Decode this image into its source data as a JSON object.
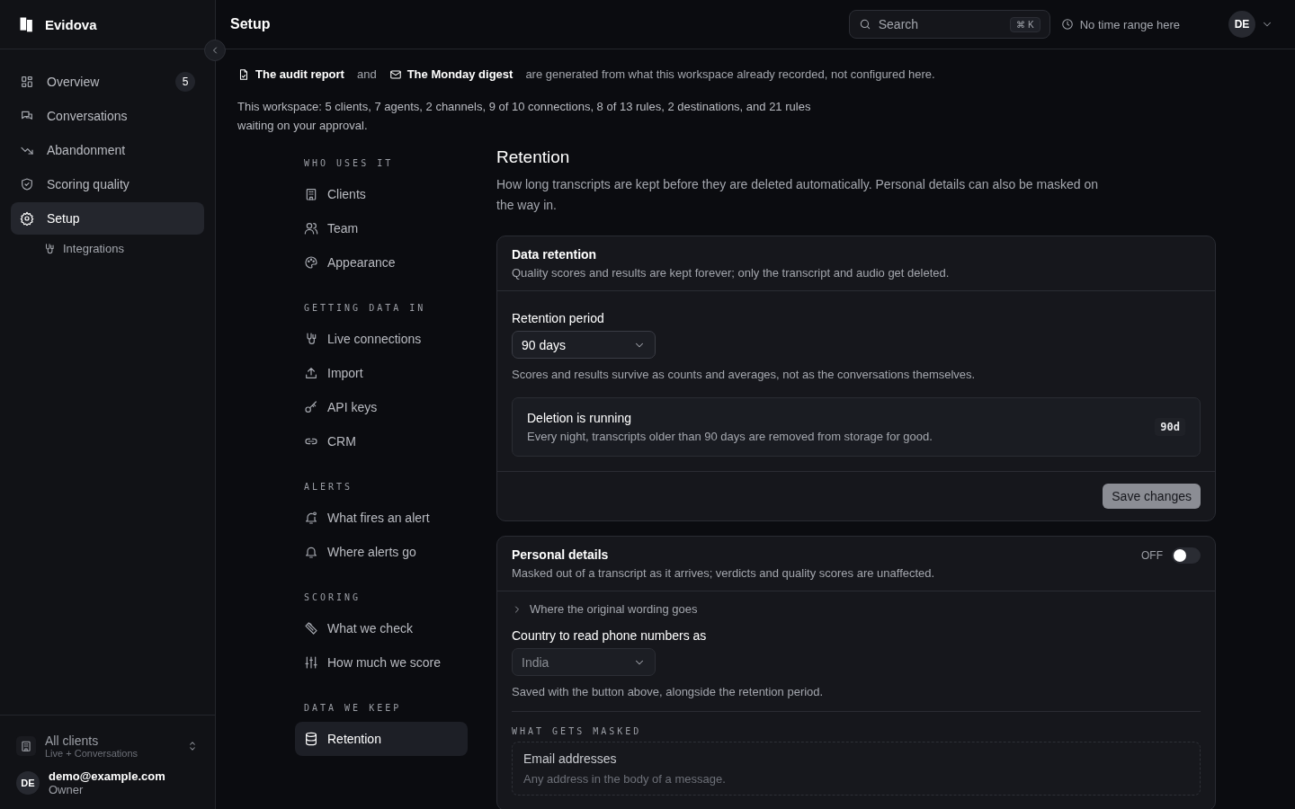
{
  "sidebar": {
    "brand": "Evidova",
    "nav": [
      {
        "label": "Overview",
        "badge": "5",
        "selected": false
      },
      {
        "label": "Conversations",
        "selected": false
      },
      {
        "label": "Abandonment",
        "selected": false
      },
      {
        "label": "Scoring quality",
        "selected": false
      },
      {
        "label": "Setup",
        "selected": true,
        "children": [
          {
            "label": "Integrations",
            "selected": false
          }
        ]
      }
    ],
    "client_switcher": {
      "title": "All clients",
      "subtitle": "Live + Conversations"
    },
    "user": {
      "initials": "DE",
      "email": "demo@example.com",
      "role": "Owner"
    }
  },
  "topbar": {
    "title": "Setup",
    "search": {
      "placeholder": "Search",
      "shortcut": "⌘ K"
    },
    "time_range": "No time range here",
    "avatar": "DE"
  },
  "notice": {
    "first": "The audit report",
    "joiner": "and",
    "second": "The Monday digest",
    "tail": "are generated from what this workspace already recorded, not configured here."
  },
  "summary": "This workspace: 5 clients, 7 agents, 2 channels, 9 of 10 connections, 8 of 13 rules, 2 destinations, and 21 rules waiting on your approval.",
  "settings_nav": [
    {
      "heading": "WHO USES IT",
      "items": [
        {
          "label": "Clients",
          "selected": false
        },
        {
          "label": "Team",
          "selected": false
        },
        {
          "label": "Appearance",
          "selected": false
        }
      ]
    },
    {
      "heading": "GETTING DATA IN",
      "items": [
        {
          "label": "Live connections",
          "selected": false
        },
        {
          "label": "Import",
          "selected": false
        },
        {
          "label": "API keys",
          "selected": false
        },
        {
          "label": "CRM",
          "selected": false
        }
      ]
    },
    {
      "heading": "ALERTS",
      "items": [
        {
          "label": "What fires an alert",
          "selected": false
        },
        {
          "label": "Where alerts go",
          "selected": false
        }
      ]
    },
    {
      "heading": "SCORING",
      "items": [
        {
          "label": "What we check",
          "selected": false
        },
        {
          "label": "How much we score",
          "selected": false
        }
      ]
    },
    {
      "heading": "DATA WE KEEP",
      "items": [
        {
          "label": "Retention",
          "selected": true
        }
      ]
    }
  ],
  "retention": {
    "title": "Retention",
    "description": "How long transcripts are kept before they are deleted automatically. Personal details can also be masked on the way in.",
    "data_retention": {
      "title": "Data retention",
      "description": "Quality scores and results are kept forever; only the transcript and audio get deleted.",
      "field_label": "Retention period",
      "value": "90 days",
      "disabled": false,
      "hint": "Scores and results survive as counts and averages, not as the conversations themselves.",
      "status": {
        "title": "Deletion is running",
        "text": "Every night, transcripts older than 90 days are removed from storage for good.",
        "badge": "90d"
      },
      "button": "Save changes"
    },
    "personal_details": {
      "title": "Personal details",
      "description": "Masked out of a transcript as it arrives; verdicts and quality scores are unaffected.",
      "toggle": {
        "label": "OFF",
        "on": false
      },
      "disclosure": {
        "label": "Where the original wording goes",
        "expanded": false
      },
      "field_label": "Country to read phone numbers as",
      "value": "India",
      "disabled": true,
      "hint": "Saved with the button above, alongside the retention period.",
      "masked_heading": "WHAT GETS MASKED",
      "masked": [
        {
          "title": "Email addresses",
          "description": "Any address in the body of a message."
        }
      ]
    }
  }
}
